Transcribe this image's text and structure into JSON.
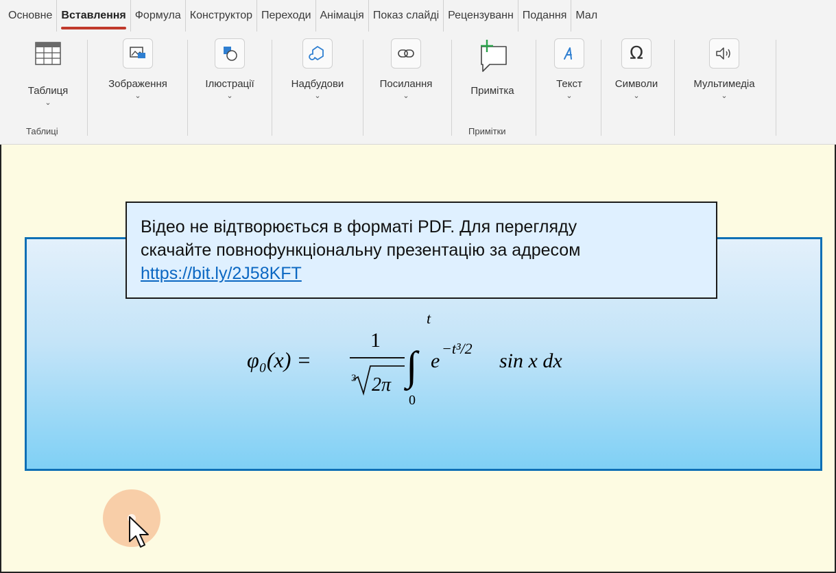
{
  "ribbon": {
    "tabs": [
      {
        "label": "Основне",
        "active": false
      },
      {
        "label": "Вставлення",
        "active": true
      },
      {
        "label": "Формула",
        "active": false
      },
      {
        "label": "Конструктор",
        "active": false
      },
      {
        "label": "Переходи",
        "active": false
      },
      {
        "label": "Анімація",
        "active": false
      },
      {
        "label": "Показ слайді",
        "active": false
      },
      {
        "label": "Рецензуванн",
        "active": false
      },
      {
        "label": "Подання",
        "active": false
      },
      {
        "label": "Мал",
        "active": false
      }
    ],
    "buttons": {
      "table": {
        "label": "Таблиця",
        "icon": "table-icon"
      },
      "images": {
        "label": "Зображення",
        "icon": "image-icon"
      },
      "illustrations": {
        "label": "Ілюстрації",
        "icon": "shapes-icon"
      },
      "addins": {
        "label": "Надбудови",
        "icon": "addins-icon"
      },
      "links": {
        "label": "Посилання",
        "icon": "link-icon"
      },
      "comment": {
        "label": "Примітка",
        "icon": "comment-icon"
      },
      "text": {
        "label": "Текст",
        "icon": "text-icon"
      },
      "symbols": {
        "label": "Символи",
        "icon": "omega-icon"
      },
      "media": {
        "label": "Мультимедіа",
        "icon": "speaker-icon"
      }
    },
    "groups": {
      "tables": "Таблиці",
      "comments": "Примітки"
    }
  },
  "slide": {
    "callout": {
      "line1": "Відео не відтворюється в форматі PDF. Для перегляду",
      "line2": "скачайте повнофункціональну презентацію за адресом",
      "link": "https://bit.ly/2J58KFT"
    },
    "formula": {
      "lhs": "φ₀(x) =",
      "numerator": "1",
      "root_index": "3",
      "radicand": "2π",
      "upper_limit": "t",
      "lower_limit": "0",
      "integrand_base": "e",
      "exponent": "−t³/2",
      "rest": "sin x dx"
    }
  },
  "colors": {
    "accent_tab": "#c0392b",
    "slide_border": "#0e6fb5",
    "link": "#0b67c2",
    "background": "#fdfbe2"
  }
}
